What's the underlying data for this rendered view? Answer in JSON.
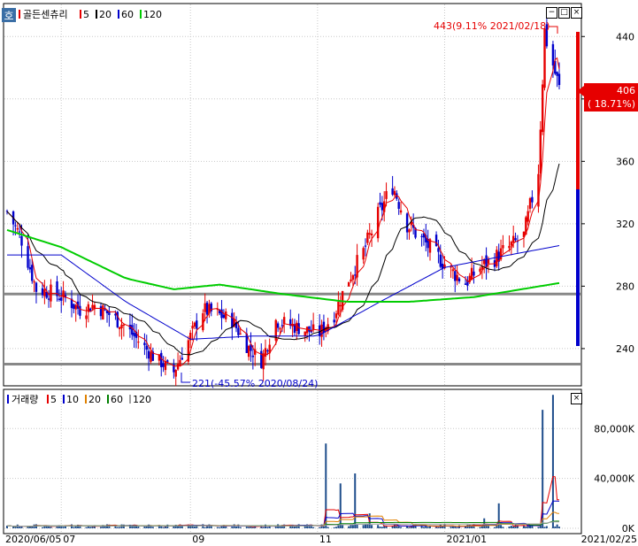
{
  "price_panel": {
    "badge": "호",
    "legend_title": "골든센츄리",
    "legend_ma": [
      {
        "label": "5",
        "color": "#e60000"
      },
      {
        "label": "20",
        "color": "#000000"
      },
      {
        "label": "60",
        "color": "#0000cc"
      },
      {
        "label": "120",
        "color": "#00cc00"
      }
    ],
    "current_price": "406",
    "current_change": "( 18.71%)",
    "high_note": "443(9.11% 2021/02/18)",
    "low_note": "221(-45.57% 2020/08/24)"
  },
  "volume_panel": {
    "legend_title": "거래량",
    "legend_ma": [
      {
        "label": "5",
        "color": "#e60000"
      },
      {
        "label": "10",
        "color": "#0000cc"
      },
      {
        "label": "20",
        "color": "#e08000"
      },
      {
        "label": "60",
        "color": "#008000"
      },
      {
        "label": "120",
        "color": "#a0a0a0"
      }
    ]
  },
  "x_axis": {
    "labels": [
      {
        "text": "2020/06/05",
        "date": "2020-06-05"
      },
      {
        "text": "07",
        "date": "2020-07"
      },
      {
        "text": "09",
        "date": "2020-09"
      },
      {
        "text": "11",
        "date": "2020-11"
      },
      {
        "text": "2021/01",
        "date": "2021-01"
      }
    ],
    "end_date": "2021/02/25"
  },
  "chart_data": [
    {
      "type": "candlestick",
      "title": "골든센츄리",
      "x_range": [
        "2020-06-05",
        "2021-02-25"
      ],
      "ylim": [
        215,
        460
      ],
      "y_ticks": [
        240,
        280,
        320,
        360,
        400,
        440
      ],
      "grid": true,
      "support_lines": [
        275,
        230
      ],
      "high": {
        "value": 443,
        "date": "2021-02-18",
        "change_pct": 9.11
      },
      "low": {
        "value": 221,
        "date": "2020-08-24",
        "change_pct": -45.57
      },
      "last": {
        "value": 406,
        "change_pct": 18.71
      },
      "close_path": [
        [
          "2020-06-05",
          328
        ],
        [
          "2020-06-12",
          310
        ],
        [
          "2020-06-19",
          278
        ],
        [
          "2020-06-26",
          276
        ],
        [
          "2020-07-03",
          272
        ],
        [
          "2020-07-10",
          265
        ],
        [
          "2020-07-17",
          268
        ],
        [
          "2020-07-24",
          262
        ],
        [
          "2020-07-31",
          255
        ],
        [
          "2020-08-07",
          245
        ],
        [
          "2020-08-14",
          235
        ],
        [
          "2020-08-24",
          225
        ],
        [
          "2020-08-31",
          245
        ],
        [
          "2020-09-07",
          265
        ],
        [
          "2020-09-14",
          262
        ],
        [
          "2020-09-21",
          258
        ],
        [
          "2020-09-28",
          242
        ],
        [
          "2020-10-05",
          232
        ],
        [
          "2020-10-12",
          258
        ],
        [
          "2020-10-19",
          255
        ],
        [
          "2020-10-26",
          252
        ],
        [
          "2020-11-02",
          250
        ],
        [
          "2020-11-09",
          262
        ],
        [
          "2020-11-16",
          285
        ],
        [
          "2020-11-23",
          302
        ],
        [
          "2020-11-30",
          325
        ],
        [
          "2020-12-07",
          345
        ],
        [
          "2020-12-14",
          320
        ],
        [
          "2020-12-21",
          310
        ],
        [
          "2020-12-28",
          300
        ],
        [
          "2021-01-04",
          290
        ],
        [
          "2021-01-11",
          282
        ],
        [
          "2021-01-18",
          292
        ],
        [
          "2021-01-25",
          298
        ],
        [
          "2021-02-01",
          305
        ],
        [
          "2021-02-08",
          312
        ],
        [
          "2021-02-15",
          355
        ],
        [
          "2021-02-18",
          443
        ],
        [
          "2021-02-25",
          406
        ]
      ],
      "ma": [
        {
          "name": "5",
          "color": "#e60000"
        },
        {
          "name": "20",
          "color": "#000000"
        },
        {
          "name": "60",
          "color": "#0000cc",
          "path": [
            [
              "2020-06-05",
              300
            ],
            [
              "2020-07-01",
              300
            ],
            [
              "2020-08-01",
              270
            ],
            [
              "2020-09-01",
              246
            ],
            [
              "2020-10-01",
              248
            ],
            [
              "2020-11-01",
              248
            ],
            [
              "2020-12-01",
              270
            ],
            [
              "2021-01-01",
              292
            ],
            [
              "2021-02-01",
              300
            ],
            [
              "2021-02-25",
              306
            ]
          ]
        },
        {
          "name": "120",
          "color": "#00cc00",
          "path": [
            [
              "2020-06-05",
              316
            ],
            [
              "2020-07-01",
              305
            ],
            [
              "2020-08-01",
              285
            ],
            [
              "2020-08-24",
              278
            ],
            [
              "2020-09-15",
              281
            ],
            [
              "2020-10-15",
              275
            ],
            [
              "2020-11-15",
              270
            ],
            [
              "2020-12-15",
              270
            ],
            [
              "2021-01-15",
              273
            ],
            [
              "2021-02-25",
              282
            ]
          ]
        }
      ]
    },
    {
      "type": "bar",
      "title": "거래량",
      "ylim": [
        0,
        110000
      ],
      "y_ticks": [
        0,
        40000,
        80000
      ],
      "y_tick_labels": [
        "0K",
        "40,000K",
        "80,000K"
      ],
      "spikes": [
        {
          "date": "2020-08-28",
          "value": 2000
        },
        {
          "date": "2020-11-05",
          "value": 68000
        },
        {
          "date": "2020-11-12",
          "value": 36000
        },
        {
          "date": "2020-11-19",
          "value": 44000
        },
        {
          "date": "2020-11-26",
          "value": 12000
        },
        {
          "date": "2021-01-20",
          "value": 8000
        },
        {
          "date": "2021-01-27",
          "value": 20000
        },
        {
          "date": "2021-02-17",
          "value": 95000
        },
        {
          "date": "2021-02-22",
          "value": 107000
        }
      ]
    }
  ]
}
